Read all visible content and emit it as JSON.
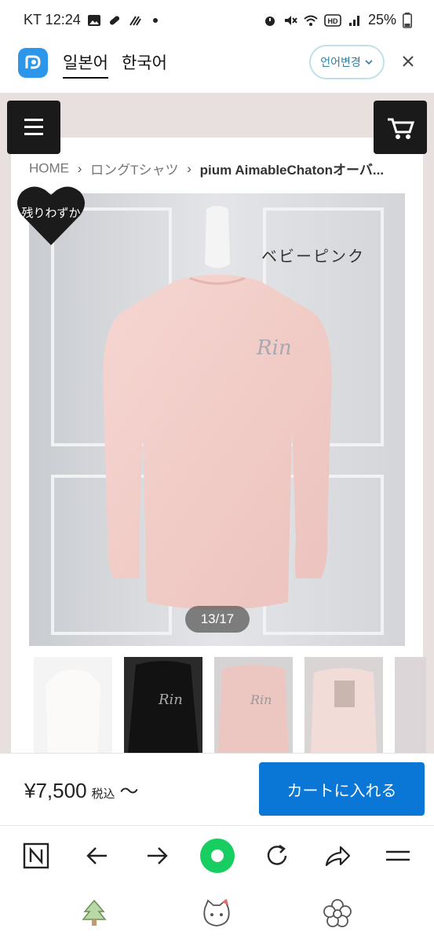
{
  "status_bar": {
    "carrier_time": "KT 12:24",
    "battery": "25%"
  },
  "translate_bar": {
    "tab_japanese": "일본어",
    "tab_korean": "한국어",
    "change_language": "언어변경"
  },
  "breadcrumb": {
    "home": "HOME",
    "category": "ロングTシャツ",
    "current": "pium AimableChatonオーバ..."
  },
  "product": {
    "badge": "残りわずか",
    "color_label": "ベビーピンク",
    "image_counter": "13/17"
  },
  "purchase": {
    "price": "¥7,500",
    "tax": "税込",
    "tilde": "〜",
    "add_to_cart": "カートに入れる"
  },
  "browser_toolbar": {
    "n_label": "N"
  },
  "colors": {
    "accent_blue": "#0a76d6",
    "site_background": "#e8e0df",
    "shirt_pink": "#f3cfca",
    "naver_green": "#19ce60"
  }
}
